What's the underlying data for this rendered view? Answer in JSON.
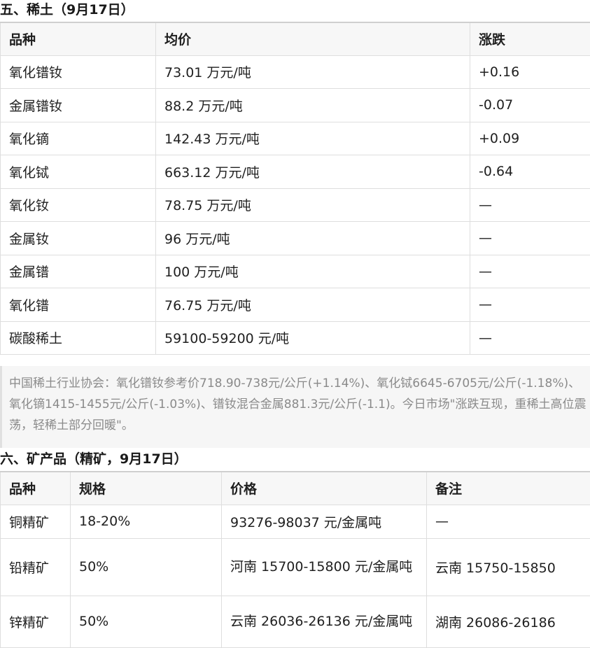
{
  "section5": {
    "title": "五、稀土（9月17日）",
    "headers": [
      "品种",
      "均价",
      "涨跌"
    ],
    "rows": [
      [
        "氧化镨钕",
        "73.01 万元/吨",
        "+0.16"
      ],
      [
        "金属镨钕",
        "88.2 万元/吨",
        "-0.07"
      ],
      [
        "氧化镝",
        "142.43 万元/吨",
        "+0.09"
      ],
      [
        "氧化铽",
        "663.12 万元/吨",
        "-0.64"
      ],
      [
        "氧化钕",
        "78.75 万元/吨",
        "—"
      ],
      [
        "金属钕",
        "96 万元/吨",
        "—"
      ],
      [
        "金属镨",
        "100 万元/吨",
        "—"
      ],
      [
        "氧化镨",
        "76.75 万元/吨",
        "—"
      ],
      [
        "碳酸稀土",
        "59100-59200 元/吨",
        "—"
      ]
    ]
  },
  "note": "中国稀土行业协会：氧化镨钕参考价718.90-738元/公斤(+1.14%)、氧化铽6645-6705元/公斤(-1.18%)、氧化镝1415-1455元/公斤(-1.03%)、镨钕混合金属881.3元/公斤(-1.1)。今日市场\"涨跌互现，重稀土高位震荡，轻稀土部分回暖\"。",
  "section6": {
    "title": "六、矿产品（精矿，9月17日）",
    "headers": [
      "品种",
      "规格",
      "价格",
      "备注"
    ],
    "rows": [
      [
        "铜精矿",
        "18-20%",
        "93276-98037 元/金属吨",
        "—"
      ],
      [
        "铅精矿",
        "50%",
        "河南 15700-15800 元/金属吨",
        "云南 15750-15850"
      ],
      [
        "锌精矿",
        "50%",
        "云南 26036-26136 元/金属吨",
        "湖南 26086-26186"
      ]
    ]
  }
}
